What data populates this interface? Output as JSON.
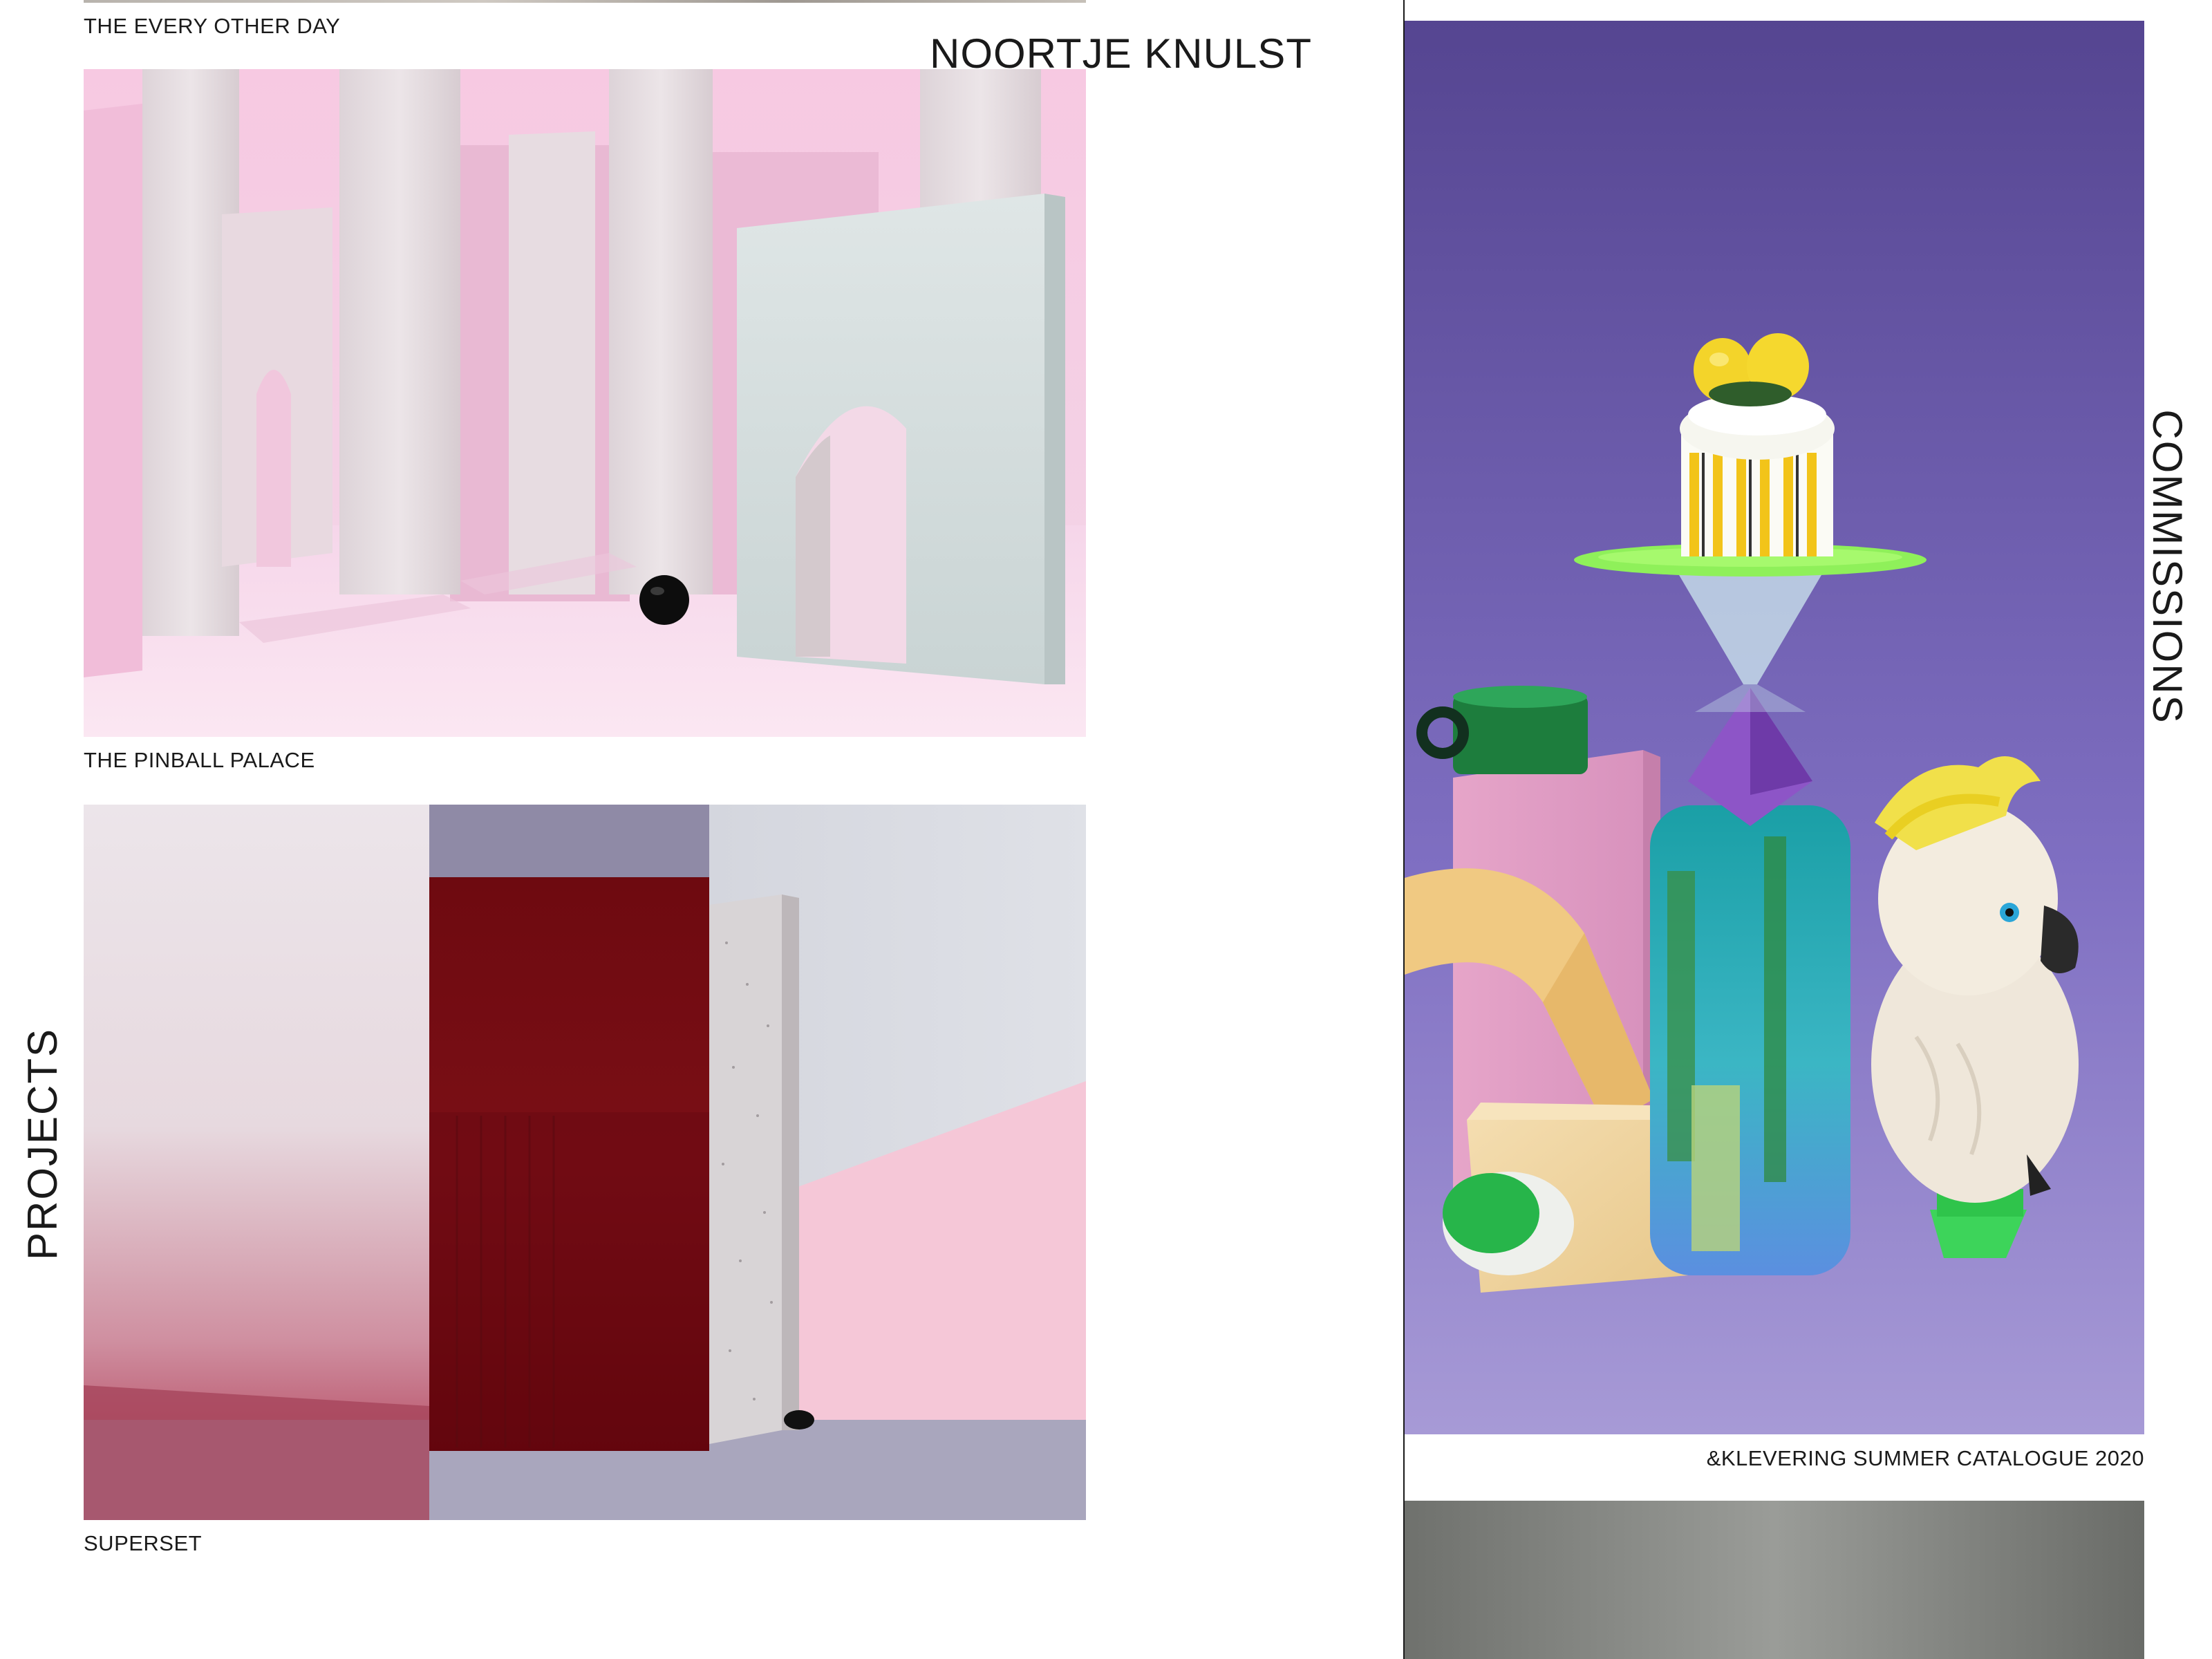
{
  "site": {
    "title": "NOORTJE KNULST"
  },
  "nav": {
    "projects_label": "PROJECTS",
    "commissions_label": "COMMISSIONS"
  },
  "projects": {
    "items": [
      {
        "caption": "THE EVERY OTHER DAY"
      },
      {
        "caption": "THE PINBALL PALACE"
      },
      {
        "caption": "SUPERSET"
      }
    ]
  },
  "commissions": {
    "items": [
      {
        "caption": "&KLEVERING SUMMER CATALOGUE 2020"
      }
    ]
  },
  "colors": {
    "text": "#1a1a1a",
    "background": "#ffffff",
    "divider": "#1a1a1a"
  }
}
